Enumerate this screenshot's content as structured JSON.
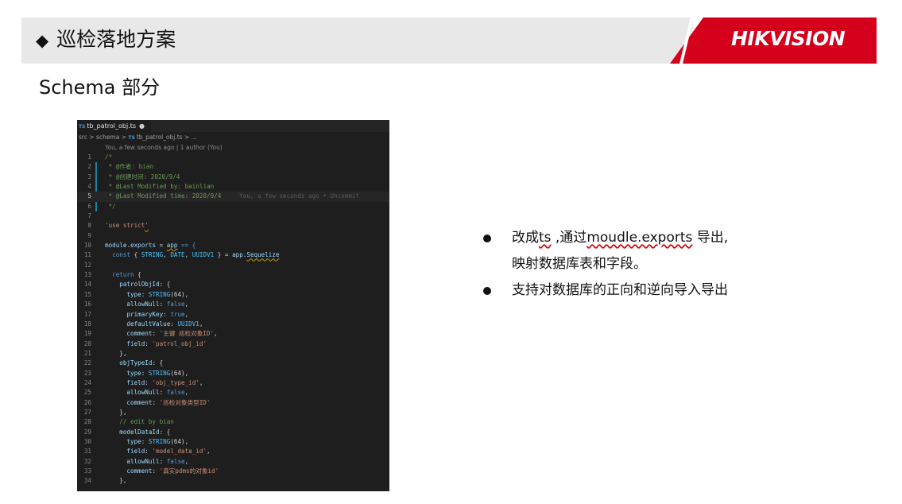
{
  "header": {
    "bullet": "◆",
    "title": "巡检落地方案",
    "logo": "HIKVISION",
    "colors": {
      "bar": "#e8e8e8",
      "logo_band": "#d5001c"
    }
  },
  "section_title": "Schema 部分",
  "editor": {
    "tab": {
      "badge": "TS",
      "filename": "tb_patrol_obj.ts",
      "modified_dot": "●"
    },
    "breadcrumb": {
      "seg1": "src",
      "sep1": " > ",
      "seg2": "schema",
      "sep2": " > ",
      "badge": "TS",
      "file": "tb_patrol_obj.ts",
      "sep3": " > ",
      "tail": "..."
    },
    "blame": "You, a few seconds ago | 1 author (You)",
    "line_numbers": [
      "1",
      "2",
      "3",
      "4",
      "5",
      "6",
      "7",
      "8",
      "9",
      "10",
      "11",
      "12",
      "13",
      "14",
      "15",
      "16",
      "17",
      "18",
      "19",
      "20",
      "21",
      "22",
      "23",
      "24",
      "25",
      "26",
      "27",
      "28",
      "29",
      "30",
      "31",
      "32",
      "33",
      "34"
    ],
    "lines": {
      "l1": "/*",
      "l2": " * @作者: bian",
      "l3": " * @创建时间: 2020/9/4",
      "l4": " * @Last Modified by: bainlian",
      "l5": " * @Last Modified time: 2020/9/4",
      "l5_blame": "     You, a few seconds ago • Uncommit",
      "l6": " */",
      "l8_a": "'use strict",
      "l8_b": "'",
      "l10_a": "module",
      "l10_b": ".",
      "l10_c": "exports",
      "l10_d": " = ",
      "l10_e": "app",
      "l10_f": " => {",
      "l11_a": "  const",
      "l11_b": " { ",
      "l11_c": "STRING",
      "l11_d": ", ",
      "l11_e": "DATE",
      "l11_f": ", ",
      "l11_g": "UUIDV1",
      "l11_h": " } = ",
      "l11_i": "app",
      "l11_j": ".",
      "l11_k": "Sequelize",
      "l13_a": "  return",
      "l13_b": " {",
      "l14_a": "    patrolObjId",
      "l14_b": ": {",
      "l15_a": "      type",
      "l15_b": ": ",
      "l15_c": "STRING",
      "l15_d": "(64),",
      "l16_a": "      allowNull",
      "l16_b": ": ",
      "l16_c": "false",
      "l16_d": ",",
      "l17_a": "      primaryKey",
      "l17_b": ": ",
      "l17_c": "true",
      "l17_d": ",",
      "l18_a": "      defaultValue",
      "l18_b": ": ",
      "l18_c": "UUIDV1",
      "l18_d": ",",
      "l19_a": "      comment",
      "l19_b": ": ",
      "l19_c": "'主键 巡检对象ID'",
      "l19_d": ",",
      "l20_a": "      field",
      "l20_b": ": ",
      "l20_c": "'patrol_obj_id'",
      "l21": "    },",
      "l22_a": "    objTypeId",
      "l22_b": ": {",
      "l23_a": "      type",
      "l23_b": ": ",
      "l23_c": "STRING",
      "l23_d": "(64),",
      "l24_a": "      field",
      "l24_b": ": ",
      "l24_c": "'obj_type_id'",
      "l24_d": ",",
      "l25_a": "      allowNull",
      "l25_b": ": ",
      "l25_c": "false",
      "l25_d": ",",
      "l26_a": "      comment",
      "l26_b": ": ",
      "l26_c": "'巡检对象类型ID'",
      "l27": "    },",
      "l28": "    // edit by bian",
      "l29_a": "    modelDataId",
      "l29_b": ": {",
      "l30_a": "      type",
      "l30_b": ": ",
      "l30_c": "STRING",
      "l30_d": "(64),",
      "l31_a": "      field",
      "l31_b": ": ",
      "l31_c": "'model_data_id'",
      "l31_d": ",",
      "l32_a": "      allowNull",
      "l32_b": ": ",
      "l32_c": "false",
      "l32_d": ",",
      "l33_a": "      comment",
      "l33_b": ": ",
      "l33_c": "'真实pdms的对象id'",
      "l34": "    },"
    }
  },
  "bullets": {
    "b1_p1": "改成",
    "b1_p2": "ts",
    "b1_p3": " ,通过",
    "b1_p4": "moudle.exports",
    "b1_p5": " 导出,",
    "b1_line2": "映射数据库表和字段。",
    "b2": "支持对数据库的正向和逆向导入导出"
  }
}
